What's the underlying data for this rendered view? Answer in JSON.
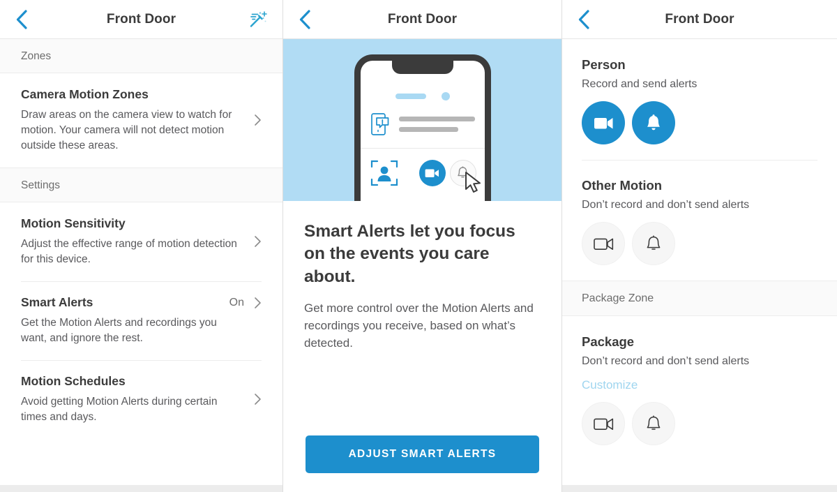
{
  "app": {
    "accent_blue": "#1d8fcd",
    "hero_blue": "#b1dcf4",
    "link_blue": "#9fd5ef",
    "text_dark": "#3b3b3b",
    "text_gray": "#59595c"
  },
  "panel1": {
    "nav": {
      "title": "Front Door",
      "back_icon": "back-chevron-icon",
      "action_icon": "magic-wand-icon"
    },
    "sections": [
      {
        "header": "Zones",
        "rows": [
          {
            "title": "Camera Motion Zones",
            "subtitle": "Draw areas on the camera view to watch for motion. Your camera will not detect motion outside these areas.",
            "value": "",
            "chevron": "chevron-right-icon"
          }
        ]
      },
      {
        "header": "Settings",
        "rows": [
          {
            "title": "Motion Sensitivity",
            "subtitle": "Adjust the effective range of motion detection for this device.",
            "value": "",
            "chevron": "chevron-right-icon"
          },
          {
            "title": "Smart Alerts",
            "subtitle": "Get the Motion Alerts and recordings you want, and ignore the rest.",
            "value": "On",
            "chevron": "chevron-right-icon"
          },
          {
            "title": "Motion Schedules",
            "subtitle": "Avoid getting Motion Alerts during certain times and days.",
            "value": "",
            "chevron": "chevron-right-icon"
          }
        ]
      }
    ]
  },
  "panel2": {
    "nav": {
      "title": "Front Door",
      "back_icon": "back-chevron-icon"
    },
    "illustration": {
      "name": "smart-alerts-phone-illustration",
      "phone_alert_icon": "phone-alert-icon",
      "person_detect_icon": "person-detection-icon",
      "record_icon": "video-camera-icon",
      "bell_icon": "bell-icon",
      "cursor_icon": "mouse-cursor-icon"
    },
    "heading": "Smart Alerts let you focus on the events you care about.",
    "body": "Get more control over the Motion Alerts and recordings you receive, based on what’s detected.",
    "cta_label": "ADJUST SMART ALERTS"
  },
  "panel3": {
    "nav": {
      "title": "Front Door",
      "back_icon": "back-chevron-icon"
    },
    "blocks": [
      {
        "kind": "item",
        "title": "Person",
        "subtitle": "Record and send alerts",
        "link": "",
        "record_on": true,
        "alert_on": true,
        "record_icon": "video-camera-icon",
        "bell_icon": "bell-icon"
      },
      {
        "kind": "item",
        "title": "Other Motion",
        "subtitle": "Don’t record and don’t send alerts",
        "link": "",
        "record_on": false,
        "alert_on": false,
        "record_icon": "video-camera-icon",
        "bell_icon": "bell-icon"
      },
      {
        "kind": "header",
        "title": "Package Zone"
      },
      {
        "kind": "item",
        "title": "Package",
        "subtitle": "Don’t record and don’t send alerts",
        "link": "Customize",
        "record_on": false,
        "alert_on": false,
        "record_icon": "video-camera-icon",
        "bell_icon": "bell-icon"
      }
    ]
  }
}
